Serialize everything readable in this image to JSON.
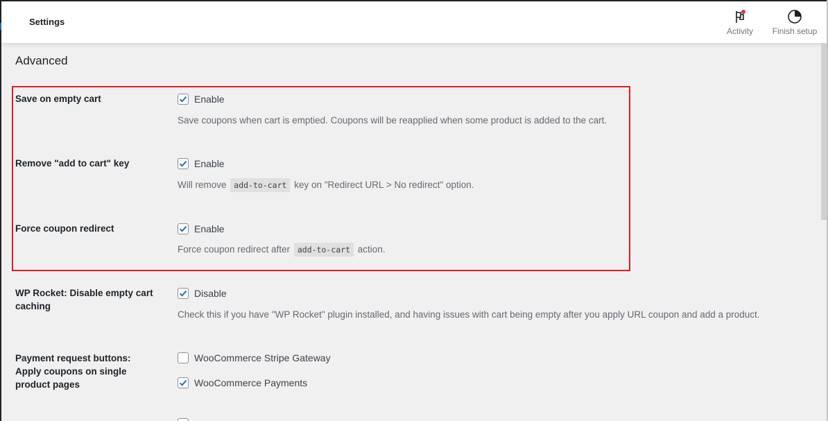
{
  "header": {
    "title": "Settings",
    "activity_label": "Activity",
    "finish_setup_label": "Finish setup"
  },
  "section": {
    "title": "Advanced"
  },
  "settings": [
    {
      "label": "Save on empty cart",
      "option": "Enable",
      "checked": true,
      "description": "Save coupons when cart is emptied. Coupons will be reapplied when some product is added to the cart."
    },
    {
      "label": "Remove \"add to cart\" key",
      "option": "Enable",
      "checked": true,
      "description_before": "Will remove",
      "description_code": "add-to-cart",
      "description_after": "key on \"Redirect URL > No redirect\" option."
    },
    {
      "label": "Force coupon redirect",
      "option": "Enable",
      "checked": true,
      "description_before": "Force coupon redirect after",
      "description_code": "add-to-cart",
      "description_after": "action."
    },
    {
      "label": "WP Rocket: Disable empty cart caching",
      "option": "Disable",
      "checked": true,
      "description": "Check this if you have \"WP Rocket\" plugin installed, and having issues with cart being empty after you apply URL coupon and add a product."
    },
    {
      "label": "Payment request buttons: Apply coupons on single product pages",
      "options": [
        {
          "label": "WooCommerce Stripe Gateway",
          "checked": false
        },
        {
          "label": "WooCommerce Payments",
          "checked": true
        }
      ]
    }
  ],
  "icons": {
    "activity": "flag-icon",
    "finish_setup": "progress-circle-icon",
    "checkmark": "checkmark-icon"
  },
  "colors": {
    "accent": "#2271b1",
    "highlight_border": "#e01b24",
    "notification_dot": "#d63638"
  }
}
